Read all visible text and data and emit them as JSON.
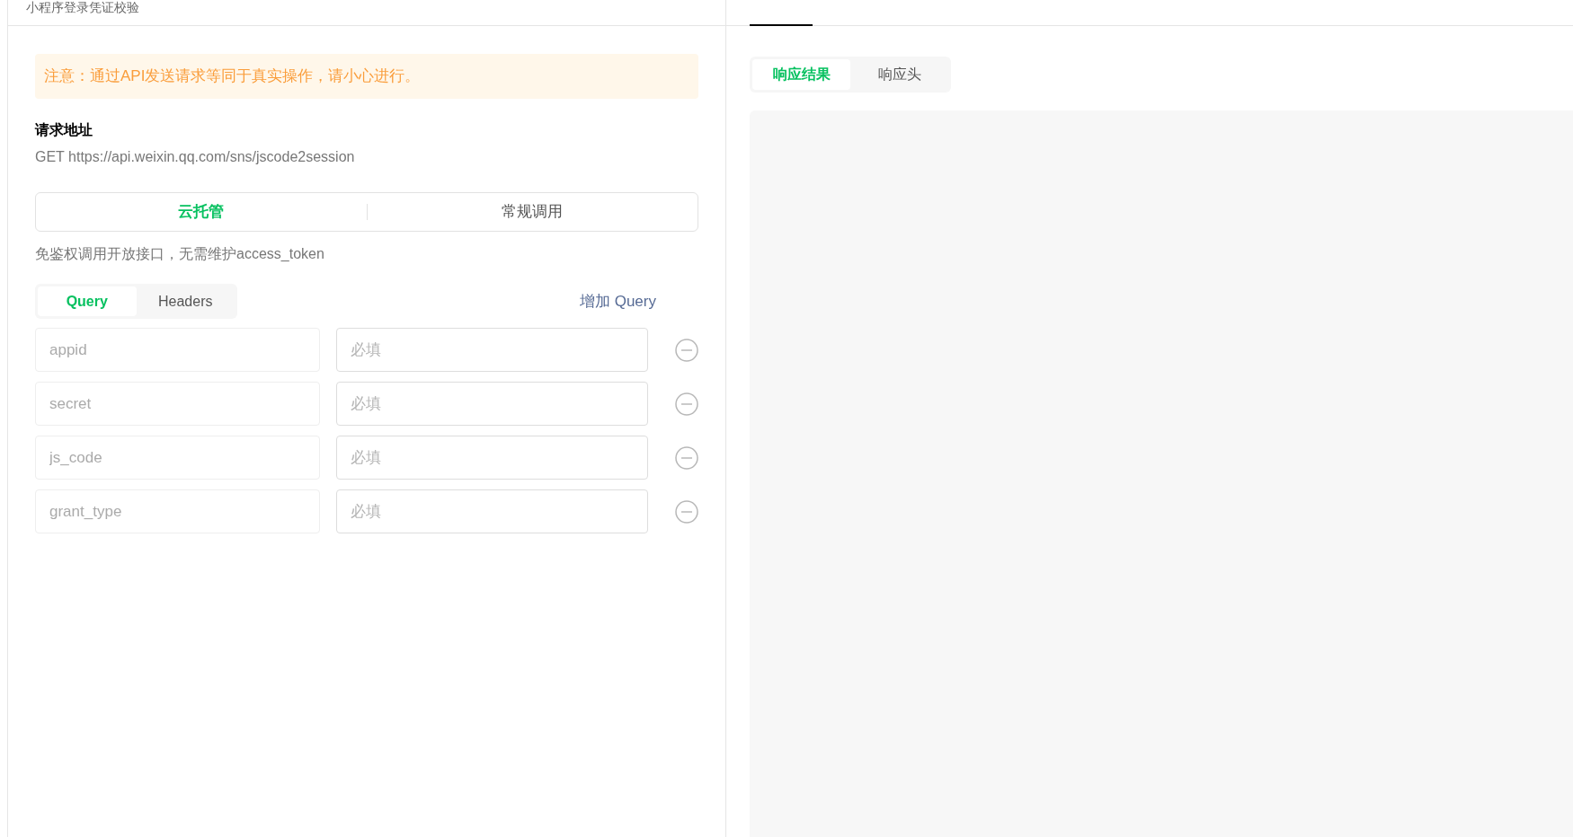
{
  "header": {
    "title": "小程序登录凭证校验"
  },
  "notice": "注意：通过API发送请求等同于真实操作，请小心进行。",
  "request": {
    "label": "请求地址",
    "address": "GET https://api.weixin.qq.com/sns/jscode2session"
  },
  "mode_tabs": [
    {
      "label": "云托管",
      "selected": true
    },
    {
      "label": "常规调用",
      "selected": false
    }
  ],
  "mode_description": "免鉴权调用开放接口，无需维护access_token",
  "param_tabs": [
    {
      "label": "Query",
      "selected": true
    },
    {
      "label": "Headers",
      "selected": false
    }
  ],
  "add_button": "增加 Query",
  "params": [
    {
      "key": "appid",
      "placeholder": "必填"
    },
    {
      "key": "secret",
      "placeholder": "必填"
    },
    {
      "key": "js_code",
      "placeholder": "必填"
    },
    {
      "key": "grant_type",
      "placeholder": "必填"
    }
  ],
  "response_tabs": [
    {
      "label": "响应结果",
      "selected": true
    },
    {
      "label": "响应头",
      "selected": false
    }
  ]
}
